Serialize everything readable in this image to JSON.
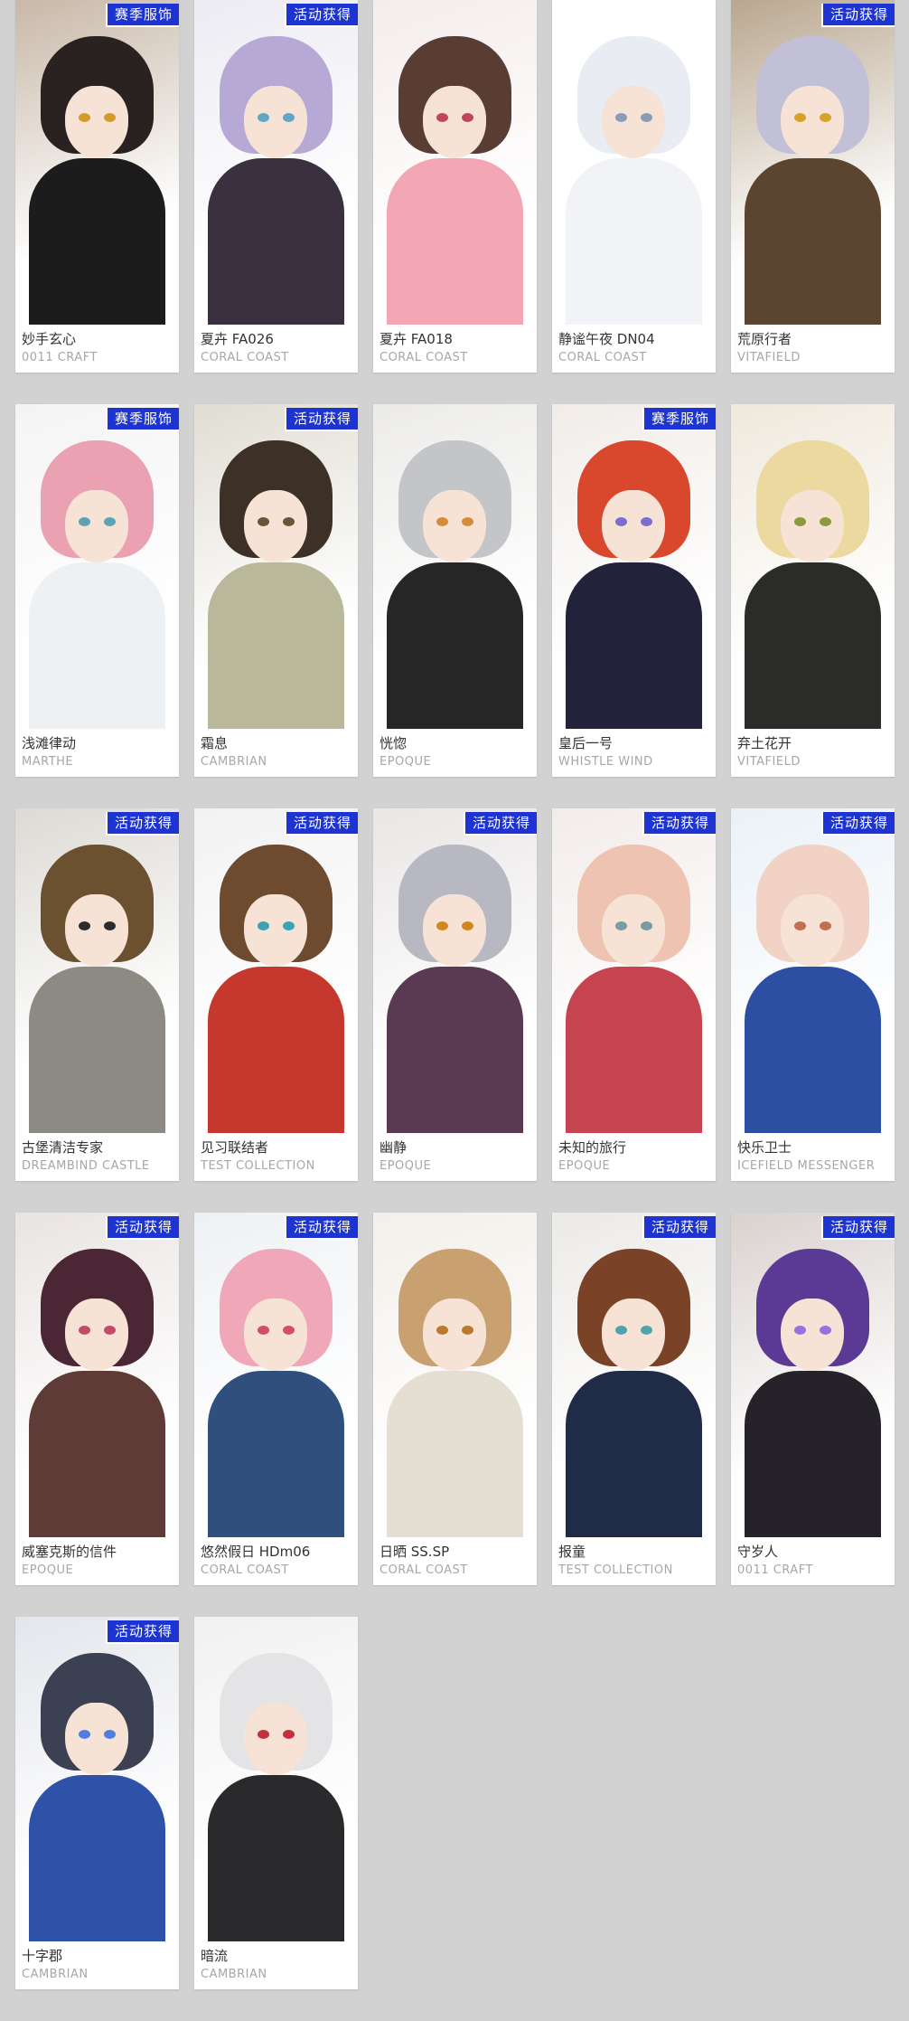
{
  "badges": {
    "season": "赛季服饰",
    "event": "活动获得"
  },
  "cards": [
    {
      "name": "妙手玄心",
      "brand": "0011 CRAFT",
      "badge": "赛季服饰",
      "hair": "#2a2220",
      "body": "#1c1c1c",
      "eye": "#d69a2a",
      "bg": "#c8b8a8"
    },
    {
      "name": "夏卉 FA026",
      "brand": "CORAL COAST",
      "badge": "活动获得",
      "hair": "#b7a9d6",
      "body": "#3a3040",
      "eye": "#5fa6c8",
      "bg": "#ecebf2"
    },
    {
      "name": "夏卉 FA018",
      "brand": "CORAL COAST",
      "badge": "",
      "hair": "#5a3d32",
      "body": "#f3a6b3",
      "eye": "#c2455b",
      "bg": "#f5ecec"
    },
    {
      "name": "静谧午夜 DN04",
      "brand": "CORAL COAST",
      "badge": "",
      "hair": "#e9ecf3",
      "body": "#f2f3f7",
      "eye": "#8a9bb8",
      "bg": "#ffffff"
    },
    {
      "name": "荒原行者",
      "brand": "VITAFIELD",
      "badge": "活动获得",
      "hair": "#c2c0d6",
      "body": "#5b4430",
      "eye": "#d6a227",
      "bg": "#b9a78f"
    },
    {
      "name": "浅滩律动",
      "brand": "MARTHE",
      "badge": "赛季服饰",
      "hair": "#eaa2b3",
      "body": "#eef1f3",
      "eye": "#5da3b2",
      "bg": "#f4f4f4"
    },
    {
      "name": "霜息",
      "brand": "CAMBRIAN",
      "badge": "活动获得",
      "hair": "#3d3027",
      "body": "#b9b89a",
      "eye": "#6b5437",
      "bg": "#e0ddd2"
    },
    {
      "name": "恍惚",
      "brand": "EPOQUE",
      "badge": "",
      "hair": "#c3c5c9",
      "body": "#262626",
      "eye": "#d48c3a",
      "bg": "#ecebe9"
    },
    {
      "name": "皇后一号",
      "brand": "WHISTLE WIND",
      "badge": "赛季服饰",
      "hair": "#d9472d",
      "body": "#22233a",
      "eye": "#7b6ed0",
      "bg": "#f1ece8"
    },
    {
      "name": "弃土花开",
      "brand": "VITAFIELD",
      "badge": "",
      "hair": "#ecd9a0",
      "body": "#2b2b29",
      "eye": "#8a9c3a",
      "bg": "#efe9dc"
    },
    {
      "name": "古堡清洁专家",
      "brand": "DREAMBIND CASTLE",
      "badge": "活动获得",
      "hair": "#6b5130",
      "body": "#8d8a84",
      "eye": "#2c2c2c",
      "bg": "#dcdad4"
    },
    {
      "name": "见习联结者",
      "brand": "TEST COLLECTION",
      "badge": "活动获得",
      "hair": "#6e4a2f",
      "body": "#c6382e",
      "eye": "#3aa3b6",
      "bg": "#f2f2f2"
    },
    {
      "name": "幽静",
      "brand": "EPOQUE",
      "badge": "活动获得",
      "hair": "#b8b8c2",
      "body": "#5a3a52",
      "eye": "#d2861f",
      "bg": "#e9e6e5"
    },
    {
      "name": "未知的旅行",
      "brand": "EPOQUE",
      "badge": "活动获得",
      "hair": "#efc3b2",
      "body": "#c5444f",
      "eye": "#7a9aa4",
      "bg": "#f2ecea"
    },
    {
      "name": "快乐卫士",
      "brand": "ICEFIELD MESSENGER",
      "badge": "活动获得",
      "hair": "#f3d2c6",
      "body": "#2d4fa3",
      "eye": "#c26e50",
      "bg": "#eaf1f7"
    },
    {
      "name": "威塞克斯的信件",
      "brand": "EPOQUE",
      "badge": "活动获得",
      "hair": "#4b2635",
      "body": "#5f3b37",
      "eye": "#c44a6a",
      "bg": "#e9e4e2"
    },
    {
      "name": "悠然假日 HDm06",
      "brand": "CORAL COAST",
      "badge": "活动获得",
      "hair": "#f0a7b8",
      "body": "#2f4f7c",
      "eye": "#d04e6a",
      "bg": "#eef1f4"
    },
    {
      "name": "日晒 SS.SP",
      "brand": "CORAL COAST",
      "badge": "",
      "hair": "#c9a06f",
      "body": "#e5dfd3",
      "eye": "#b87a2e",
      "bg": "#f3efe9"
    },
    {
      "name": "报童",
      "brand": "TEST COLLECTION",
      "badge": "活动获得",
      "hair": "#7a4327",
      "body": "#1f2b47",
      "eye": "#4ea6ac",
      "bg": "#eceae7"
    },
    {
      "name": "守岁人",
      "brand": "0011 CRAFT",
      "badge": "活动获得",
      "hair": "#5b3a95",
      "body": "#26222a",
      "eye": "#9a6fe0",
      "bg": "#d9d2cf"
    },
    {
      "name": "十字郡",
      "brand": "CAMBRIAN",
      "badge": "活动获得",
      "hair": "#3b4152",
      "body": "#2d52a8",
      "eye": "#4f7de0",
      "bg": "#e4e6ec"
    },
    {
      "name": "暗流",
      "brand": "CAMBRIAN",
      "badge": "",
      "hair": "#e4e4e6",
      "body": "#2a2a2c",
      "eye": "#c3303b",
      "bg": "#f1f1f1"
    }
  ]
}
